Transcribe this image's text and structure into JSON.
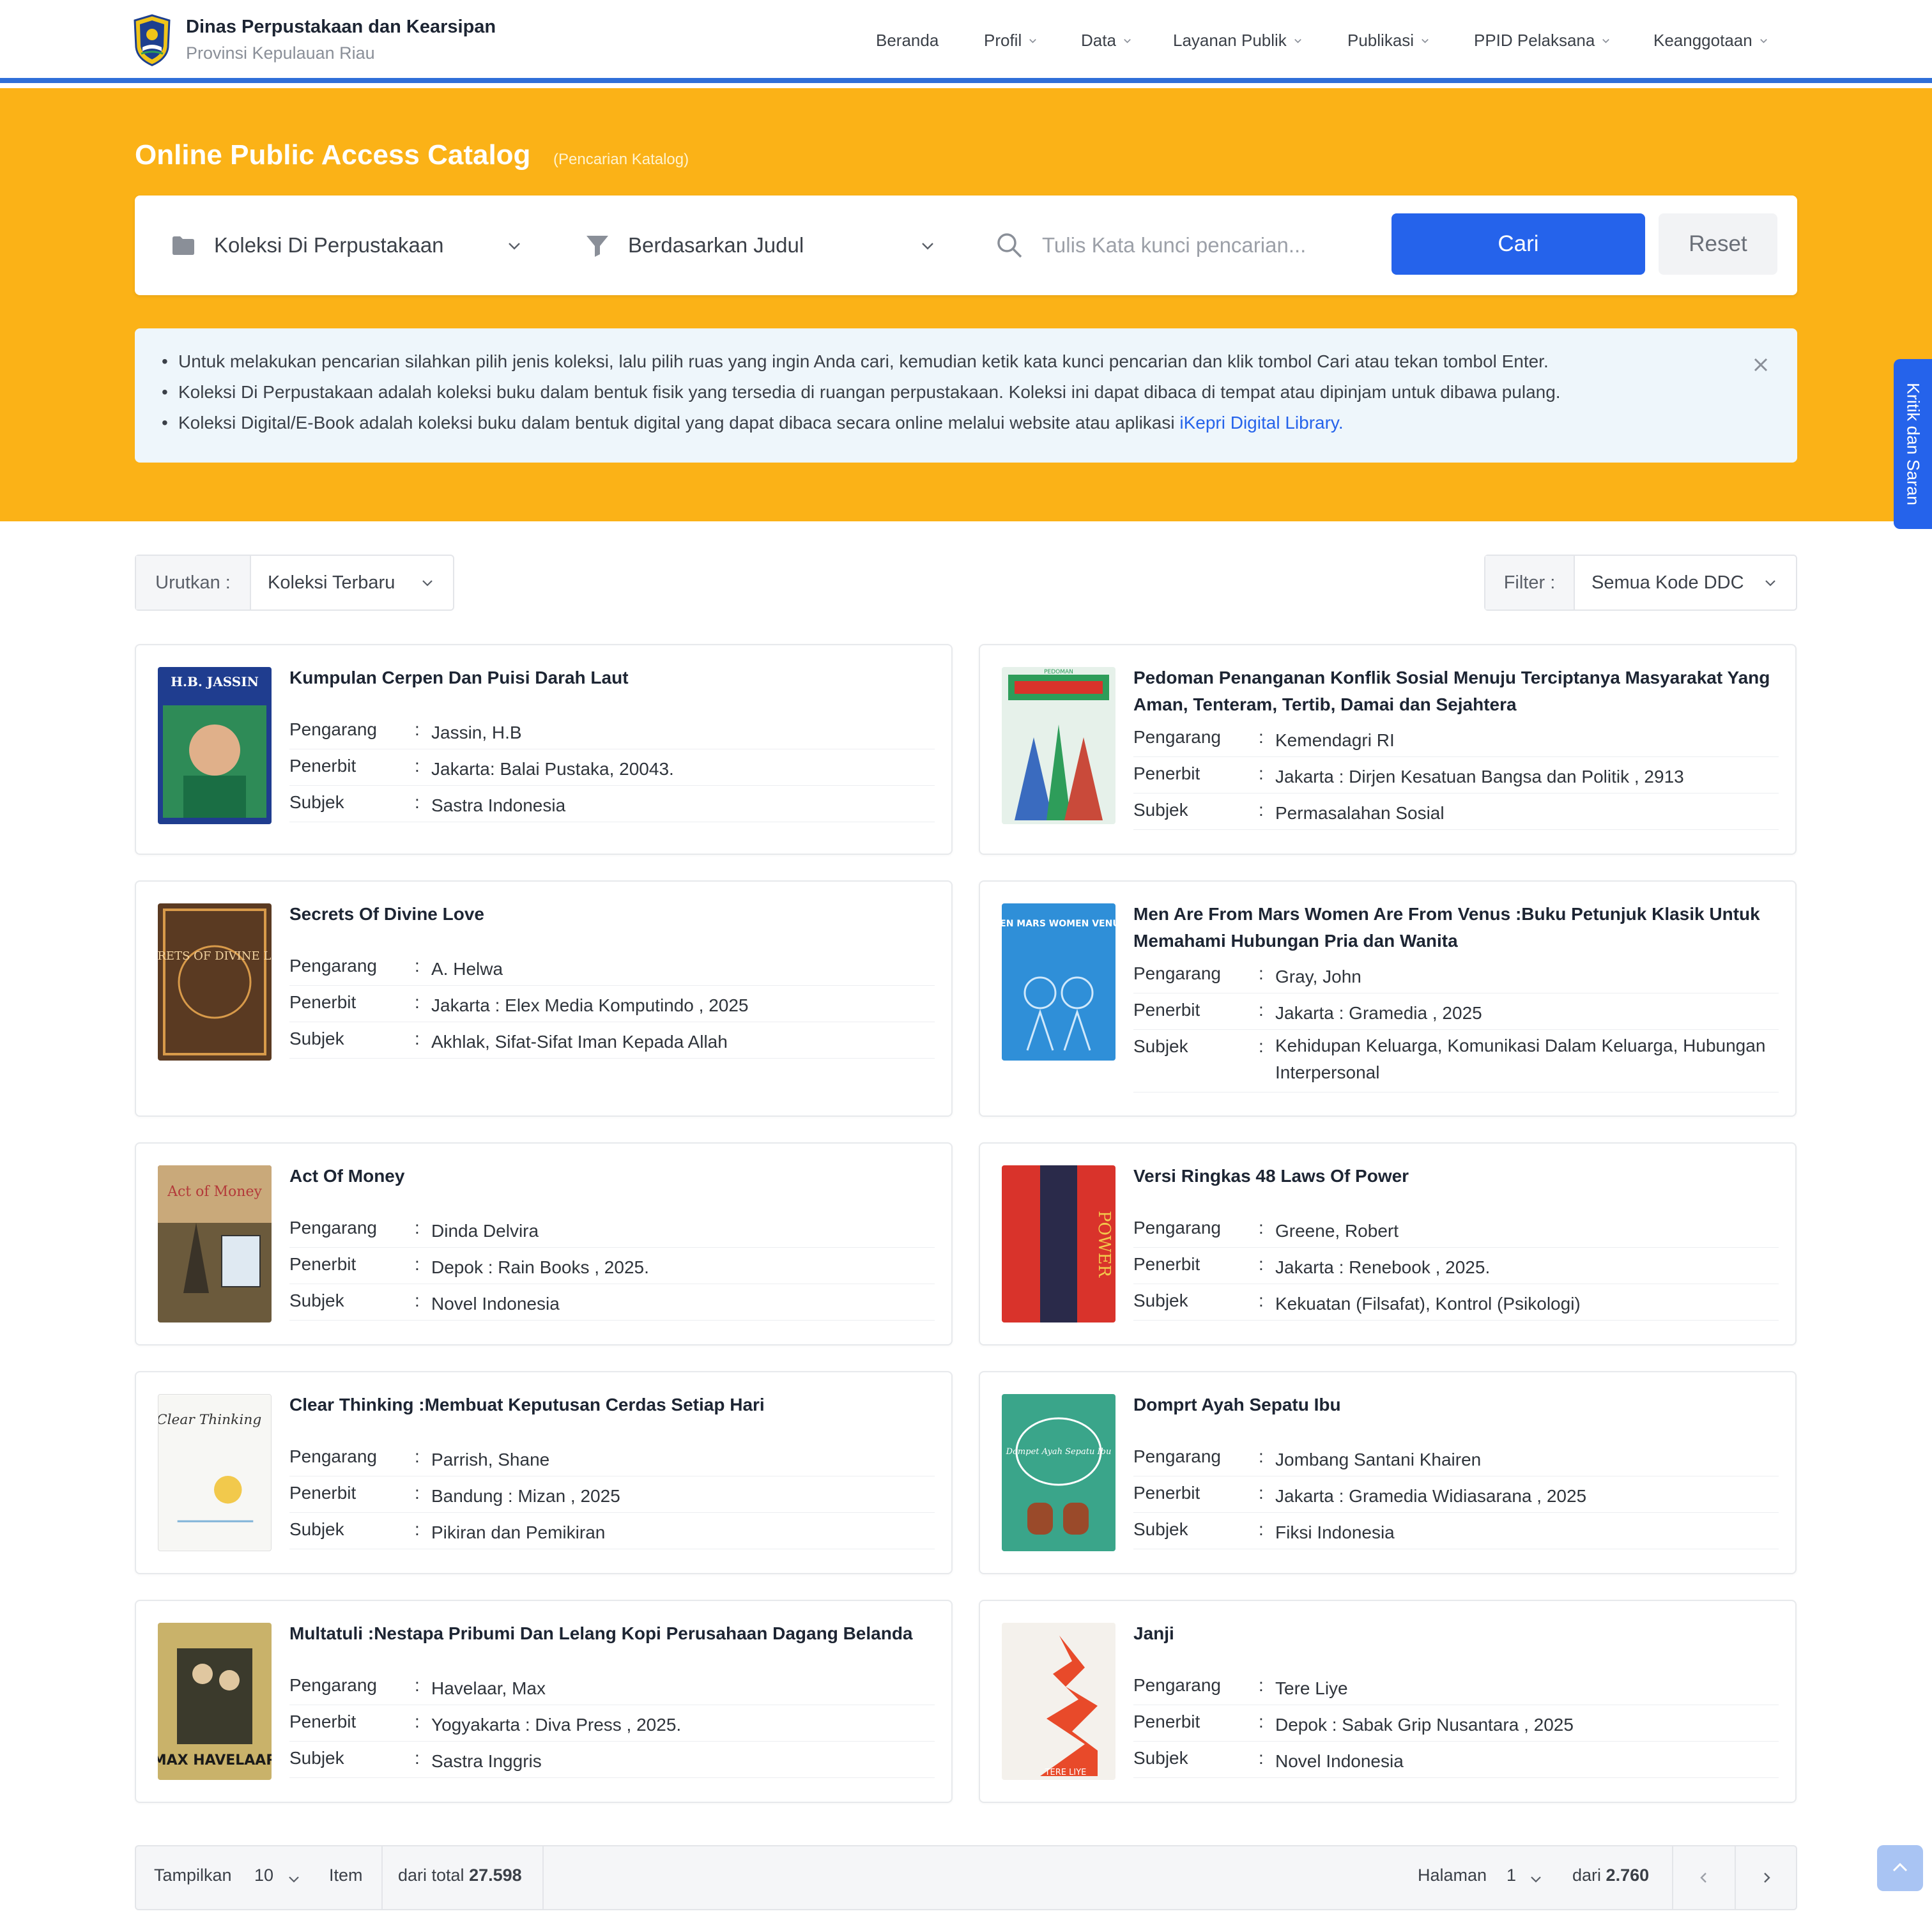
{
  "header": {
    "title": "Dinas Perpustakaan dan Kearsipan",
    "subtitle": "Provinsi Kepulauan Riau",
    "nav": [
      {
        "label": "Beranda"
      },
      {
        "label": "Profil"
      },
      {
        "label": "Data"
      },
      {
        "label": "Layanan Publik"
      },
      {
        "label": "Publikasi"
      },
      {
        "label": "PPID Pelaksana"
      },
      {
        "label": "Keanggotaan"
      }
    ]
  },
  "hero": {
    "title": "Online Public Access Catalog",
    "subtitle": "(Pencarian Katalog)"
  },
  "search": {
    "collection": "Koleksi Di Perpustakaan",
    "field": "Berdasarkan Judul",
    "placeholder": "Tulis Kata kunci pencarian...",
    "value": "",
    "search_label": "Cari",
    "reset_label": "Reset"
  },
  "info": {
    "line1": "Untuk melakukan pencarian silahkan pilih jenis koleksi, lalu pilih ruas yang ingin Anda cari, kemudian ketik kata kunci pencarian dan klik tombol Cari atau tekan tombol Enter.",
    "line2": "Koleksi Di Perpustakaan adalah koleksi buku dalam bentuk fisik yang tersedia di ruangan perpustakaan. Koleksi ini dapat dibaca di tempat atau dipinjam untuk dibawa pulang.",
    "line3_prefix": "Koleksi Digital/E-Book adalah koleksi buku dalam bentuk digital yang dapat dibaca secara online melalui website atau aplikasi ",
    "line3_link": "iKepri Digital Library",
    "line3_suffix": "."
  },
  "feedback_tab": "Kritik dan Saran",
  "toolbar": {
    "sort_label": "Urutkan :",
    "sort_value": "Koleksi Terbaru",
    "filter_label": "Filter :",
    "filter_value": "Semua Kode DDC"
  },
  "labels": {
    "author": "Pengarang",
    "publisher": "Penerbit",
    "subject": "Subjek",
    "sep": ":"
  },
  "books": [
    {
      "title": "Kumpulan Cerpen Dan Puisi Darah Laut",
      "author": "Jassin, H.B",
      "publisher": "Jakarta: Balai Pustaka, 20043.",
      "subject": "Sastra Indonesia",
      "cover_text": "H.B. JASSIN",
      "cover_color": "#1f3d8f"
    },
    {
      "title": "Pedoman Penanganan Konflik Sosial Menuju Terciptanya Masyarakat Yang Aman, Tenteram, Tertib, Damai dan Sejahtera",
      "author": "Kemendagri RI",
      "publisher": "Jakarta : Dirjen Kesatuan Bangsa dan Politik , 2913",
      "subject": "Permasalahan Sosial",
      "cover_text": "PEDOMAN",
      "cover_color": "#2e9d5a"
    },
    {
      "title": "Secrets Of Divine Love",
      "author": "A. Helwa",
      "publisher": "Jakarta : Elex Media Komputindo , 2025",
      "subject": "Akhlak, Sifat-Sifat Iman Kepada Allah",
      "cover_text": "SECRETS OF DIVINE LOVE",
      "cover_color": "#5a3a22"
    },
    {
      "title": "Men Are From Mars Women Are From Venus :Buku Petunjuk Klasik Untuk Memahami Hubungan Pria dan Wanita",
      "author": "Gray, John",
      "publisher": "Jakarta : Gramedia , 2025",
      "subject": "Kehidupan Keluarga, Komunikasi Dalam Keluarga, Hubungan Interpersonal",
      "cover_text": "MEN MARS WOMEN VENUS",
      "cover_color": "#2f8fd8"
    },
    {
      "title": "Act Of Money",
      "author": "Dinda Delvira",
      "publisher": "Depok : Rain Books , 2025.",
      "subject": "Novel Indonesia",
      "cover_text": "Act of Money",
      "cover_color": "#6b5a3c"
    },
    {
      "title": "Versi Ringkas 48 Laws Of Power",
      "author": "Greene, Robert",
      "publisher": "Jakarta : Renebook , 2025.",
      "subject": "Kekuatan (Filsafat), Kontrol (Psikologi)",
      "cover_text": "POWER",
      "cover_color": "#d9332b"
    },
    {
      "title": "Clear Thinking :Membuat Keputusan Cerdas Setiap Hari",
      "author": "Parrish, Shane",
      "publisher": "Bandung : Mizan , 2025",
      "subject": "Pikiran dan Pemikiran",
      "cover_text": "Clear Thinking",
      "cover_color": "#f7f7f4"
    },
    {
      "title": "Domprt Ayah Sepatu Ibu",
      "author": "Jombang Santani Khairen",
      "publisher": "Jakarta : Gramedia Widiasarana , 2025",
      "subject": "Fiksi Indonesia",
      "cover_text": "Dompet Ayah Sepatu Ibu",
      "cover_color": "#3aa58a"
    },
    {
      "title": "Multatuli :Nestapa Pribumi Dan Lelang Kopi Perusahaan Dagang Belanda",
      "author": "Havelaar, Max",
      "publisher": "Yogyakarta : Diva Press , 2025.",
      "subject": "Sastra Inggris",
      "cover_text": "MAX HAVELAAR",
      "cover_color": "#c9b26a"
    },
    {
      "title": "Janji",
      "author": "Tere Liye",
      "publisher": "Depok : Sabak Grip Nusantara , 2025",
      "subject": "Novel Indonesia",
      "cover_text": "TERE LIYE",
      "cover_color": "#f4f1ec"
    }
  ],
  "pagination": {
    "show_label": "Tampilkan",
    "per_page": "10",
    "item_label": "Item",
    "total_prefix": "dari total",
    "total": "27.598",
    "page_label": "Halaman",
    "page": "1",
    "pages_prefix": "dari",
    "pages": "2.760"
  },
  "colors": {
    "accent": "#2563eb",
    "hero": "#fbb217",
    "info_bg": "#eef6fb"
  }
}
